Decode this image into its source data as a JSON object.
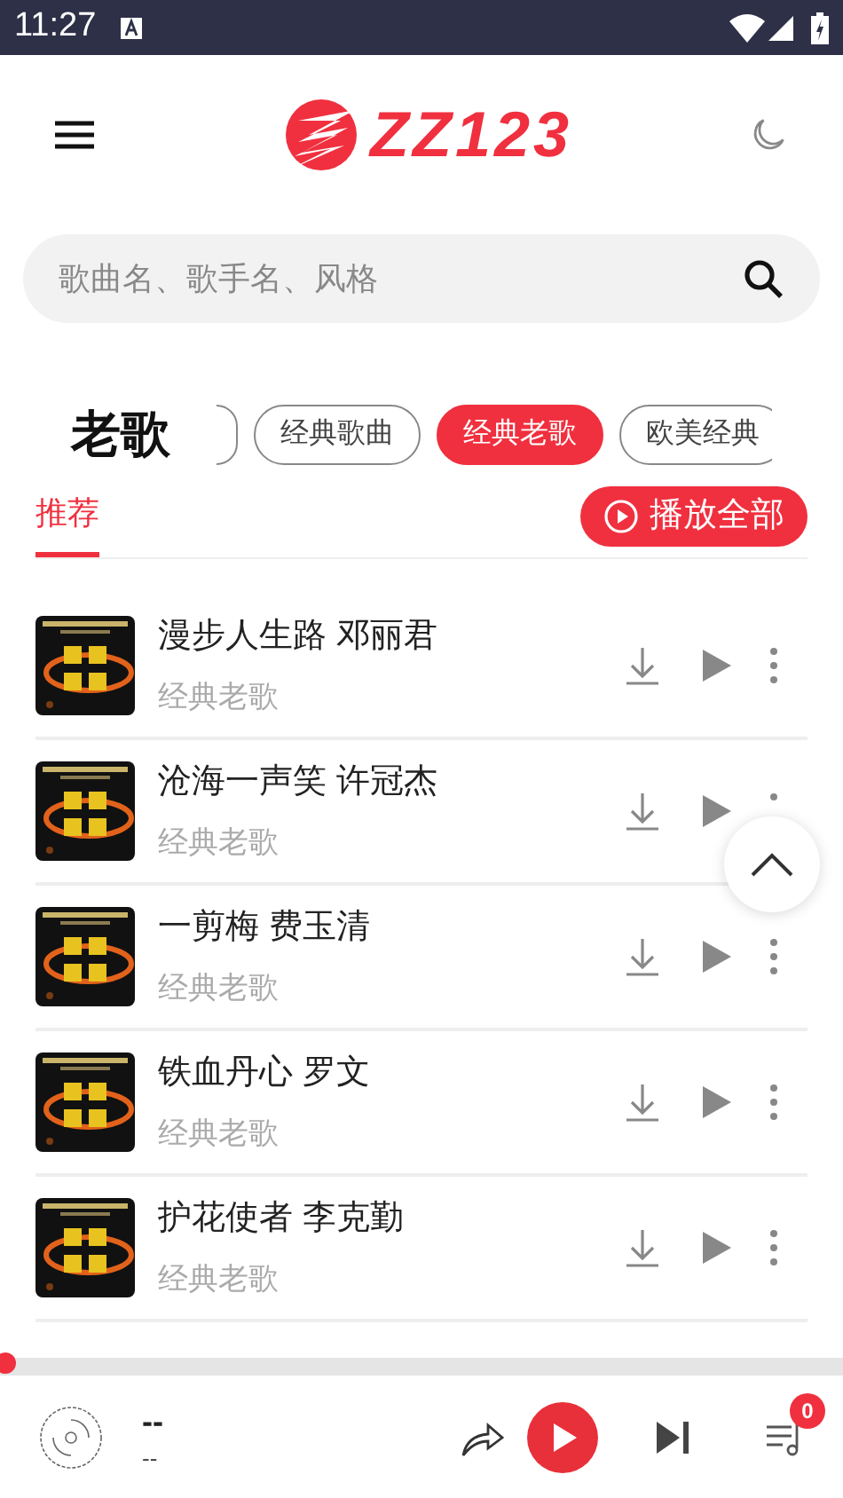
{
  "status_bar": {
    "time": "11:27"
  },
  "header": {
    "logo": "ZZ123"
  },
  "search": {
    "placeholder": "歌曲名、歌手名、风格"
  },
  "category": {
    "title": "老歌"
  },
  "chips": [
    {
      "label": "经典歌曲",
      "selected": false
    },
    {
      "label": "经典老歌",
      "selected": true
    },
    {
      "label": "欧美经典",
      "selected": false
    }
  ],
  "tabs": [
    {
      "label": "推荐",
      "selected": true
    }
  ],
  "play_all": "播放全部",
  "songs": [
    {
      "title": "漫步人生路 邓丽君",
      "subtitle": "经典老歌"
    },
    {
      "title": "沧海一声笑 许冠杰",
      "subtitle": "经典老歌"
    },
    {
      "title": "一剪梅 费玉清",
      "subtitle": "经典老歌"
    },
    {
      "title": "铁血丹心 罗文",
      "subtitle": "经典老歌"
    },
    {
      "title": "护花使者 李克勤",
      "subtitle": "经典老歌"
    }
  ],
  "player": {
    "title": "--",
    "artist": "--",
    "level": 0,
    "queue_count": "0"
  }
}
